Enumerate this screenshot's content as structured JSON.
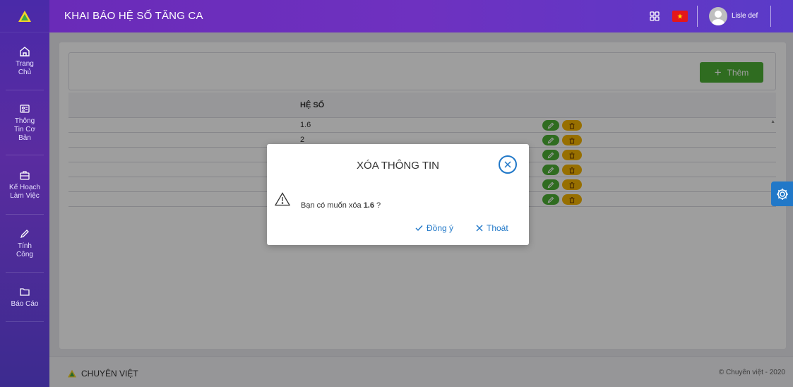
{
  "header": {
    "title": "KHAI BÁO HỆ SỐ TĂNG CA",
    "username": "Lisle def"
  },
  "sidebar": {
    "items": [
      {
        "label": "Trang\nChủ",
        "icon": "home-icon"
      },
      {
        "label": "Thông\nTin Cơ\nBản",
        "icon": "id-card-icon"
      },
      {
        "label": "Kế Hoạch\nLàm Việc",
        "icon": "briefcase-icon"
      },
      {
        "label": "Tính\nCông",
        "icon": "pencil-icon"
      },
      {
        "label": "Báo Cáo",
        "icon": "folder-icon"
      }
    ]
  },
  "toolbar": {
    "add_label": "Thêm"
  },
  "table": {
    "column": "HỆ SỐ",
    "rows": [
      "1.6",
      "2",
      "",
      "",
      "",
      ""
    ]
  },
  "modal": {
    "title": "XÓA THÔNG TIN",
    "message_prefix": "Bạn có muốn xóa",
    "message_value": "1.6",
    "message_suffix": " ?",
    "confirm_label": "Đồng ý",
    "cancel_label": "Thoát"
  },
  "footer": {
    "brand": "CHUYÊN VIỆT",
    "copyright": "© Chuyên việt - 2020"
  },
  "colors": {
    "accent": "#2178c8",
    "add": "#4caf35",
    "delete": "#f4b400",
    "header": "#6a2bb8"
  }
}
